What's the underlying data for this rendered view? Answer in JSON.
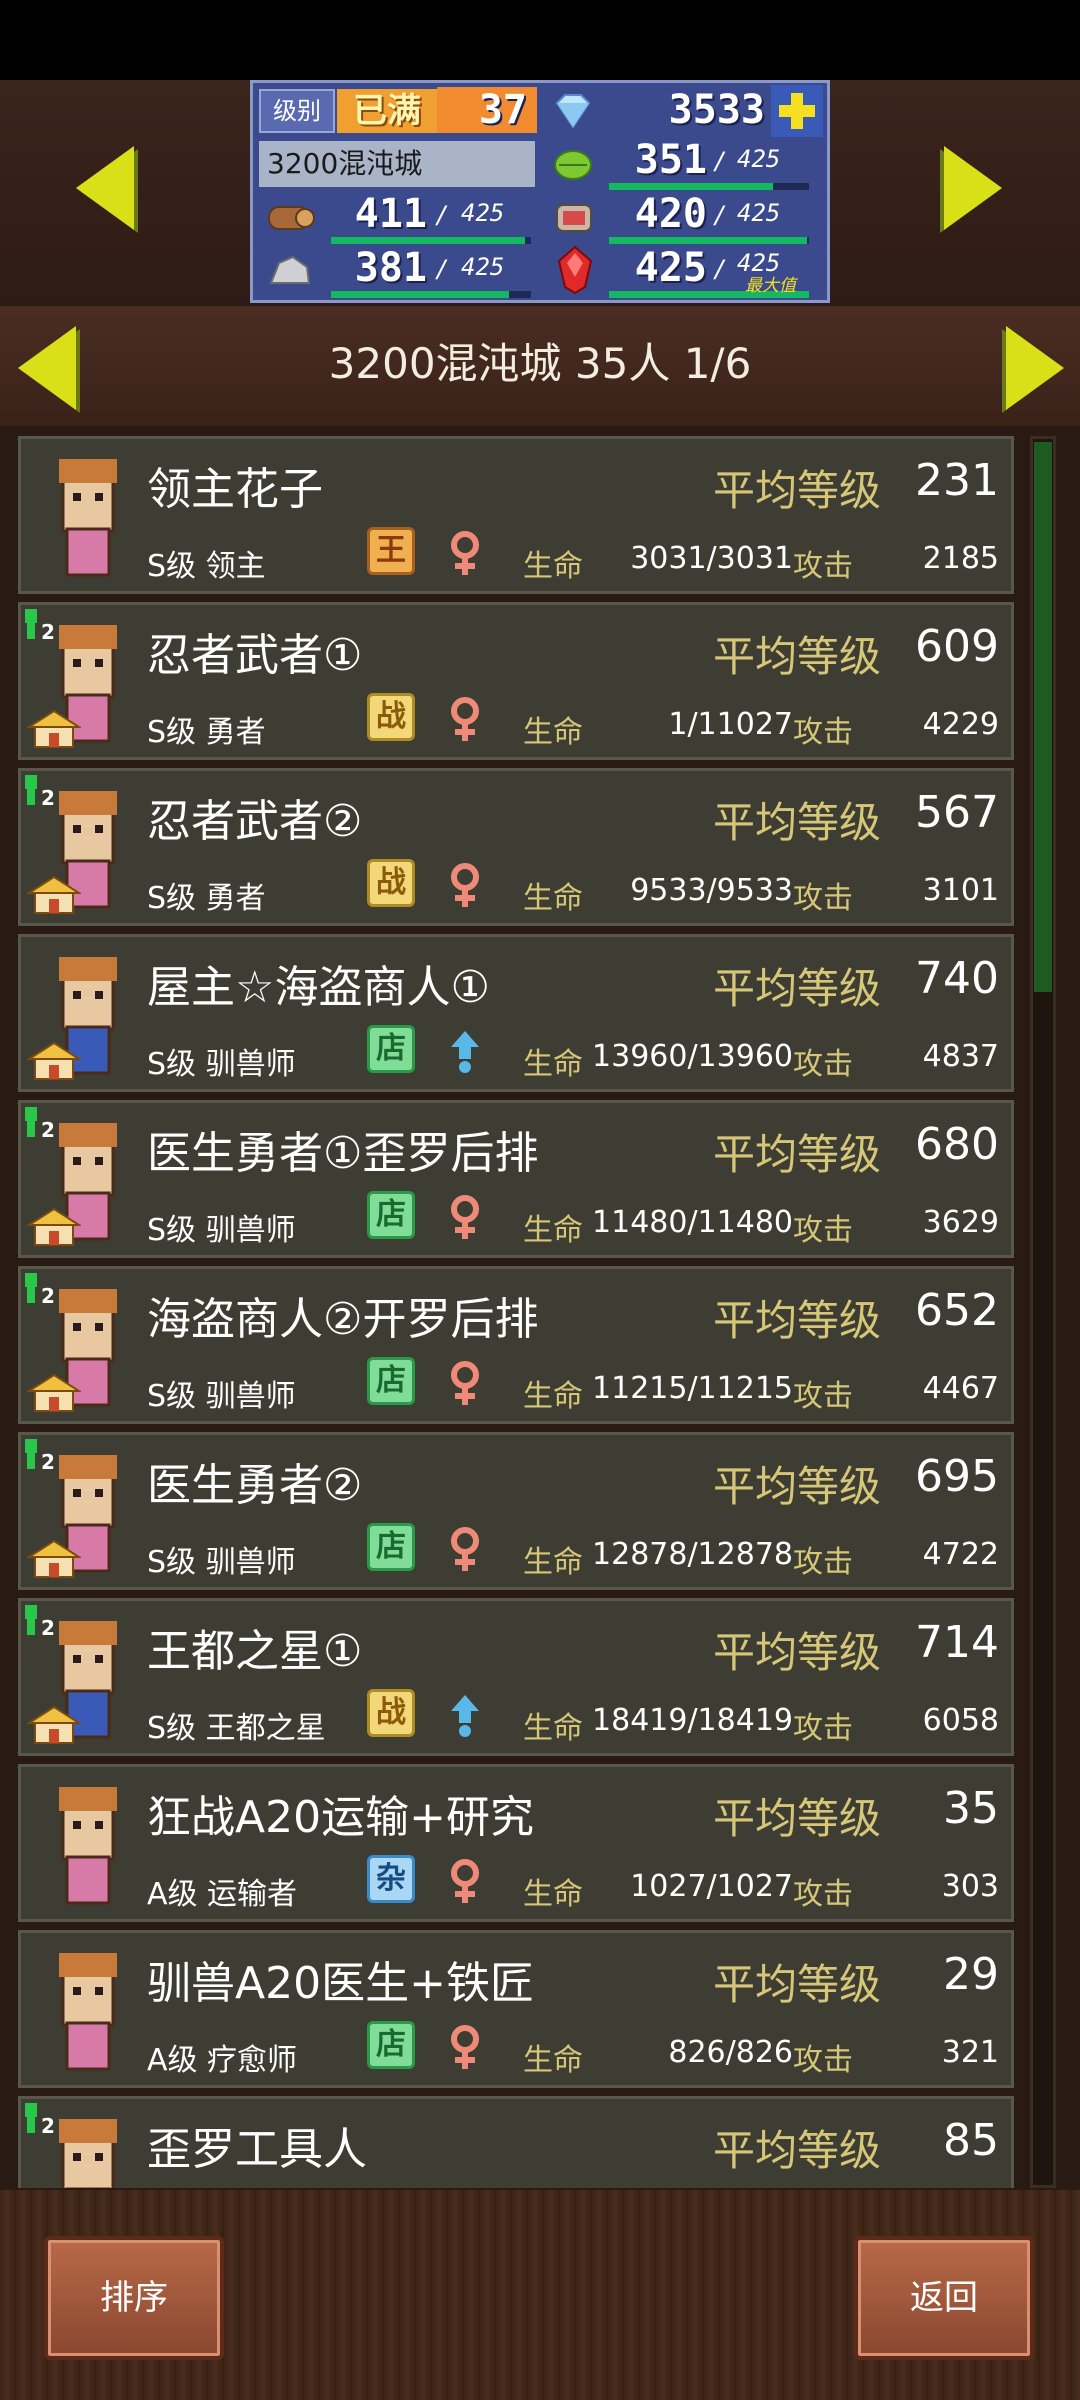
{
  "resources": {
    "level_label": "级别",
    "level_status": "已满",
    "level_value": "37",
    "gems": "3533",
    "city_name_box": "3200混沌城",
    "crop": {
      "value": "351",
      "max": "425"
    },
    "wood": {
      "value": "411",
      "max": "425"
    },
    "meat": {
      "value": "420",
      "max": "425"
    },
    "stone": {
      "value": "381",
      "max": "425"
    },
    "ruby": {
      "value": "425",
      "max": "425",
      "badge": "最大值"
    }
  },
  "city_bar": {
    "title": "3200混沌城  35人 1/6"
  },
  "units": [
    {
      "name": "领主花子",
      "avg_label": "平均等级",
      "avg": "231",
      "class": "S级 领主",
      "tag": "王",
      "tag_type": "king",
      "gender": "female",
      "hp_label": "生命",
      "hp": "3031/3031",
      "atk_label": "攻击",
      "atk": "2185",
      "rank_badge": "",
      "has_house": false
    },
    {
      "name": "忍者武者①",
      "avg_label": "平均等级",
      "avg": "609",
      "class": "S级 勇者",
      "tag": "战",
      "tag_type": "war",
      "gender": "female",
      "hp_label": "生命",
      "hp": "1/11027",
      "atk_label": "攻击",
      "atk": "4229",
      "rank_badge": "2",
      "has_house": true
    },
    {
      "name": "忍者武者②",
      "avg_label": "平均等级",
      "avg": "567",
      "class": "S级 勇者",
      "tag": "战",
      "tag_type": "war",
      "gender": "female",
      "hp_label": "生命",
      "hp": "9533/9533",
      "atk_label": "攻击",
      "atk": "3101",
      "rank_badge": "2",
      "has_house": true
    },
    {
      "name": "屋主☆海盗商人①",
      "avg_label": "平均等级",
      "avg": "740",
      "class": "S级 驯兽师",
      "tag": "店",
      "tag_type": "shop",
      "gender": "male",
      "hp_label": "生命",
      "hp": "13960/13960",
      "atk_label": "攻击",
      "atk": "4837",
      "rank_badge": "",
      "has_house": true
    },
    {
      "name": "医生勇者①歪罗后排",
      "avg_label": "平均等级",
      "avg": "680",
      "class": "S级 驯兽师",
      "tag": "店",
      "tag_type": "shop",
      "gender": "female",
      "hp_label": "生命",
      "hp": "11480/11480",
      "atk_label": "攻击",
      "atk": "3629",
      "rank_badge": "2",
      "has_house": true
    },
    {
      "name": "海盗商人②开罗后排",
      "avg_label": "平均等级",
      "avg": "652",
      "class": "S级 驯兽师",
      "tag": "店",
      "tag_type": "shop",
      "gender": "female",
      "hp_label": "生命",
      "hp": "11215/11215",
      "atk_label": "攻击",
      "atk": "4467",
      "rank_badge": "2",
      "has_house": true
    },
    {
      "name": "医生勇者②",
      "avg_label": "平均等级",
      "avg": "695",
      "class": "S级 驯兽师",
      "tag": "店",
      "tag_type": "shop",
      "gender": "female",
      "hp_label": "生命",
      "hp": "12878/12878",
      "atk_label": "攻击",
      "atk": "4722",
      "rank_badge": "2",
      "has_house": true
    },
    {
      "name": "王都之星①",
      "avg_label": "平均等级",
      "avg": "714",
      "class": "S级 王都之星",
      "tag": "战",
      "tag_type": "war",
      "gender": "male",
      "hp_label": "生命",
      "hp": "18419/18419",
      "atk_label": "攻击",
      "atk": "6058",
      "rank_badge": "2",
      "has_house": true
    },
    {
      "name": "狂战A20运输+研究",
      "avg_label": "平均等级",
      "avg": "35",
      "class": "A级 运输者",
      "tag": "杂",
      "tag_type": "misc",
      "gender": "female",
      "hp_label": "生命",
      "hp": "1027/1027",
      "atk_label": "攻击",
      "atk": "303",
      "rank_badge": "",
      "has_house": false
    },
    {
      "name": "驯兽A20医生+铁匠",
      "avg_label": "平均等级",
      "avg": "29",
      "class": "A级 疗愈师",
      "tag": "店",
      "tag_type": "shop",
      "gender": "female",
      "hp_label": "生命",
      "hp": "826/826",
      "atk_label": "攻击",
      "atk": "321",
      "rank_badge": "",
      "has_house": false
    },
    {
      "name": "歪罗工具人",
      "avg_label": "平均等级",
      "avg": "85",
      "class": "",
      "tag": "",
      "tag_type": "",
      "gender": "",
      "hp_label": "",
      "hp": "",
      "atk_label": "",
      "atk": "",
      "rank_badge": "2",
      "has_house": false
    }
  ],
  "buttons": {
    "sort": "排序",
    "back": "返回"
  },
  "colors": {
    "accent_yellow": "#d9e018",
    "label_gold": "#d6c678",
    "bar_green": "#14b860"
  }
}
